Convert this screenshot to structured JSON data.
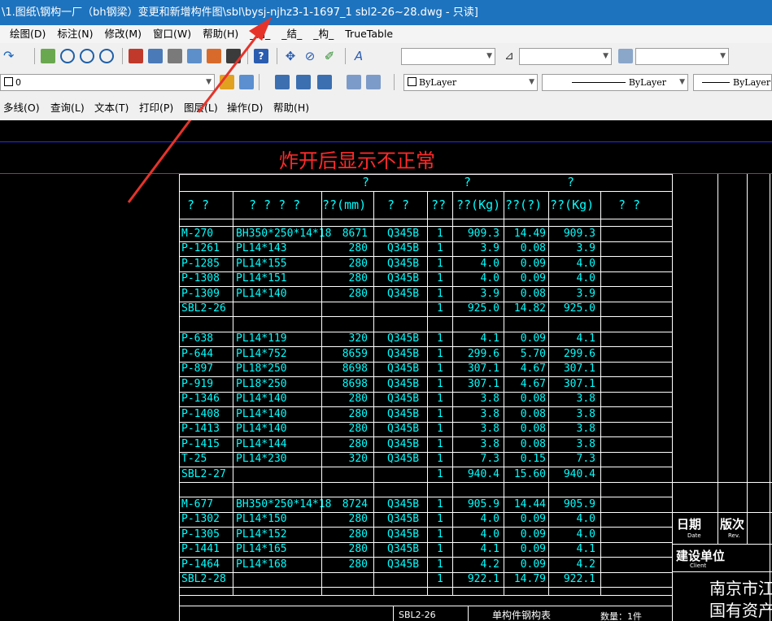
{
  "window": {
    "title": "\\1.图纸\\钢构一厂（bh钢梁）变更和新增构件图\\sbl\\bysj-njhz3-1-1697_1  sbl2-26~28.dwg - 只读]"
  },
  "menu": [
    "绘图(D)",
    "标注(N)",
    "修改(M)",
    "窗口(W)",
    "帮助(H)",
    "_钢_",
    "_结_",
    "_构_",
    "TrueTable"
  ],
  "toolbar": {
    "layer_value": "0",
    "color_value": "ByLayer",
    "linetype_value": "ByLayer",
    "lineweight_value": "ByLayer"
  },
  "toolbar3_menu": [
    "多线(O)",
    "查询(L)",
    "文本(T)",
    "打印(P)",
    "图层(L)",
    "操作(D)",
    "帮助(H)"
  ],
  "annotation": {
    "text": "炸开后显示不正常",
    "color": "#ff2a2a"
  },
  "table": {
    "header_top": [
      "?",
      "?",
      "?"
    ],
    "header": [
      "? ?",
      "? ? ? ?",
      "??(mm)",
      "? ?",
      "??",
      "??(Kg)",
      "??(?)",
      "??(Kg)",
      "?    ?"
    ],
    "groups": [
      {
        "rows": [
          [
            "M-270",
            "BH350*250*14*18",
            "8671",
            "Q345B",
            "1",
            "909.3",
            "14.49",
            "909.3"
          ],
          [
            "P-1261",
            "PL14*143",
            "280",
            "Q345B",
            "1",
            "3.9",
            "0.08",
            "3.9"
          ],
          [
            "P-1285",
            "PL14*155",
            "280",
            "Q345B",
            "1",
            "4.0",
            "0.09",
            "4.0"
          ],
          [
            "P-1308",
            "PL14*151",
            "280",
            "Q345B",
            "1",
            "4.0",
            "0.09",
            "4.0"
          ],
          [
            "P-1309",
            "PL14*140",
            "280",
            "Q345B",
            "1",
            "3.9",
            "0.08",
            "3.9"
          ]
        ],
        "subtotal": [
          "SBL2-26",
          "1",
          "925.0",
          "14.82",
          "925.0"
        ]
      },
      {
        "rows": [
          [
            "P-638",
            "PL14*119",
            "320",
            "Q345B",
            "1",
            "4.1",
            "0.09",
            "4.1"
          ],
          [
            "P-644",
            "PL14*752",
            "8659",
            "Q345B",
            "1",
            "299.6",
            "5.70",
            "299.6"
          ],
          [
            "P-897",
            "PL18*250",
            "8698",
            "Q345B",
            "1",
            "307.1",
            "4.67",
            "307.1"
          ],
          [
            "P-919",
            "PL18*250",
            "8698",
            "Q345B",
            "1",
            "307.1",
            "4.67",
            "307.1"
          ],
          [
            "P-1346",
            "PL14*140",
            "280",
            "Q345B",
            "1",
            "3.8",
            "0.08",
            "3.8"
          ],
          [
            "P-1408",
            "PL14*140",
            "280",
            "Q345B",
            "1",
            "3.8",
            "0.08",
            "3.8"
          ],
          [
            "P-1413",
            "PL14*140",
            "280",
            "Q345B",
            "1",
            "3.8",
            "0.08",
            "3.8"
          ],
          [
            "P-1415",
            "PL14*144",
            "280",
            "Q345B",
            "1",
            "3.8",
            "0.08",
            "3.8"
          ],
          [
            "T-25",
            "PL14*230",
            "320",
            "Q345B",
            "1",
            "7.3",
            "0.15",
            "7.3"
          ]
        ],
        "subtotal": [
          "SBL2-27",
          "1",
          "940.4",
          "15.60",
          "940.4"
        ]
      },
      {
        "rows": [
          [
            "M-677",
            "BH350*250*14*18",
            "8724",
            "Q345B",
            "1",
            "905.9",
            "14.44",
            "905.9"
          ],
          [
            "P-1302",
            "PL14*150",
            "280",
            "Q345B",
            "1",
            "4.0",
            "0.09",
            "4.0"
          ],
          [
            "P-1305",
            "PL14*152",
            "280",
            "Q345B",
            "1",
            "4.0",
            "0.09",
            "4.0"
          ],
          [
            "P-1441",
            "PL14*165",
            "280",
            "Q345B",
            "1",
            "4.1",
            "0.09",
            "4.1"
          ],
          [
            "P-1464",
            "PL14*168",
            "280",
            "Q345B",
            "1",
            "4.2",
            "0.09",
            "4.2"
          ]
        ],
        "subtotal": [
          "SBL2-28",
          "1",
          "922.1",
          "14.79",
          "922.1"
        ]
      }
    ]
  },
  "title_block": {
    "date": "日期",
    "date_en": "Date",
    "rev": "版次",
    "rev_en": "Rev.",
    "client": "建设单位",
    "client_en": "Client",
    "company_line1": "南京市江",
    "company_line2": "国有资产",
    "footer_code": "SBL2-26",
    "footer_title": "单构件钢构表",
    "footer_qty": "数量：1件"
  }
}
